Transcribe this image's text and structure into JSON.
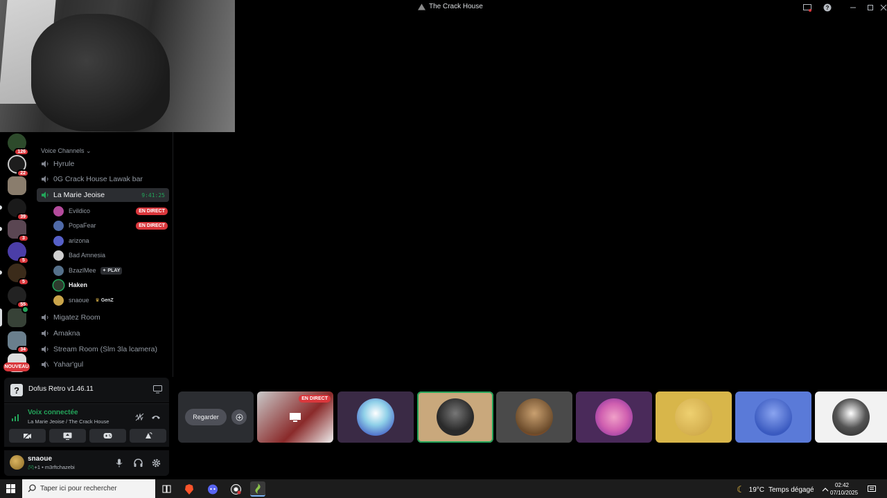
{
  "window": {
    "title": "The Crack House"
  },
  "rail": {
    "guilds": [
      {
        "badge": "126",
        "color": "#2d4a2b"
      },
      {
        "badge": "22",
        "color": "#1d1d1d"
      },
      {
        "badge": "",
        "color": "#8a7d6d"
      },
      {
        "badge": "39",
        "color": "#1a1a1a"
      },
      {
        "badge": "3",
        "color": "#5a4652"
      },
      {
        "badge": "5",
        "color": "#4b3ea8"
      },
      {
        "badge": "5",
        "color": "#3b2b1a"
      },
      {
        "badge": "55",
        "color": "#222"
      },
      {
        "badge": "",
        "color": "#374237"
      },
      {
        "badge": "34",
        "color": "#6a7f8d"
      }
    ],
    "new_label": "NOUVEAU"
  },
  "sidebar": {
    "category": "Voice Channels",
    "channels": [
      {
        "name": "Hyrule"
      },
      {
        "name": "0G Crack House Lawak bar"
      },
      {
        "name": "La Marie Jeoise",
        "timer": "9:41:25"
      }
    ],
    "members": [
      {
        "name": "Evildico",
        "live": "EN DIRECT",
        "color": "#b44b9c"
      },
      {
        "name": "PopaFear",
        "live": "EN DIRECT",
        "color": "#4f6aa8"
      },
      {
        "name": "arizona",
        "color": "#5660c8"
      },
      {
        "name": "Bad Amnesia",
        "color": "#cfcfcf"
      },
      {
        "name": "BzazlMee",
        "tag": "PLAY",
        "color": "#55708a"
      },
      {
        "name": "Haken",
        "color": "#2e3b2e"
      },
      {
        "name": "snaoue",
        "tag": "GenZ",
        "color": "#c9a44a"
      }
    ],
    "more_channels": [
      {
        "name": "Migatez Room"
      },
      {
        "name": "Amakna"
      },
      {
        "name": "Stream Room (Slm 3la lcamera)"
      },
      {
        "name": "Yahar'gul"
      }
    ]
  },
  "activity": {
    "game": "Dofus Retro v1.46.11",
    "icon": "?"
  },
  "voice": {
    "status": "Voix connectée",
    "location": "La Marie Jeoise / The Crack House"
  },
  "user": {
    "name": "snaoue",
    "status": "+1 • m3rftchazebi"
  },
  "strip": {
    "watch_label": "Regarder",
    "live_label": "EN DIRECT",
    "tiles": [
      {
        "bg": "#3a2a45",
        "avatar": "#8fd0e8"
      },
      {
        "bg": "#c9a87c",
        "avatar": "#2a2a2a",
        "speaking": true
      },
      {
        "bg": "#4a4a4a",
        "avatar": "#8a6a4a"
      },
      {
        "bg": "#4a2a5a",
        "avatar": "#d060b0"
      },
      {
        "bg": "#d8b64a",
        "avatar": "#e0c050"
      },
      {
        "bg": "#5a7ad8",
        "avatar": "#4a6ac8"
      },
      {
        "bg": "#f2f2f2",
        "avatar": "#2a2a2a"
      }
    ]
  },
  "taskbar": {
    "search_placeholder": "Taper ici pour rechercher",
    "temperature": "19°C",
    "weather": "Temps dégagé",
    "time": "02:42",
    "date": "07/10/2025"
  },
  "colors": {
    "accent_green": "#23a55a",
    "live_red": "#da373c"
  }
}
